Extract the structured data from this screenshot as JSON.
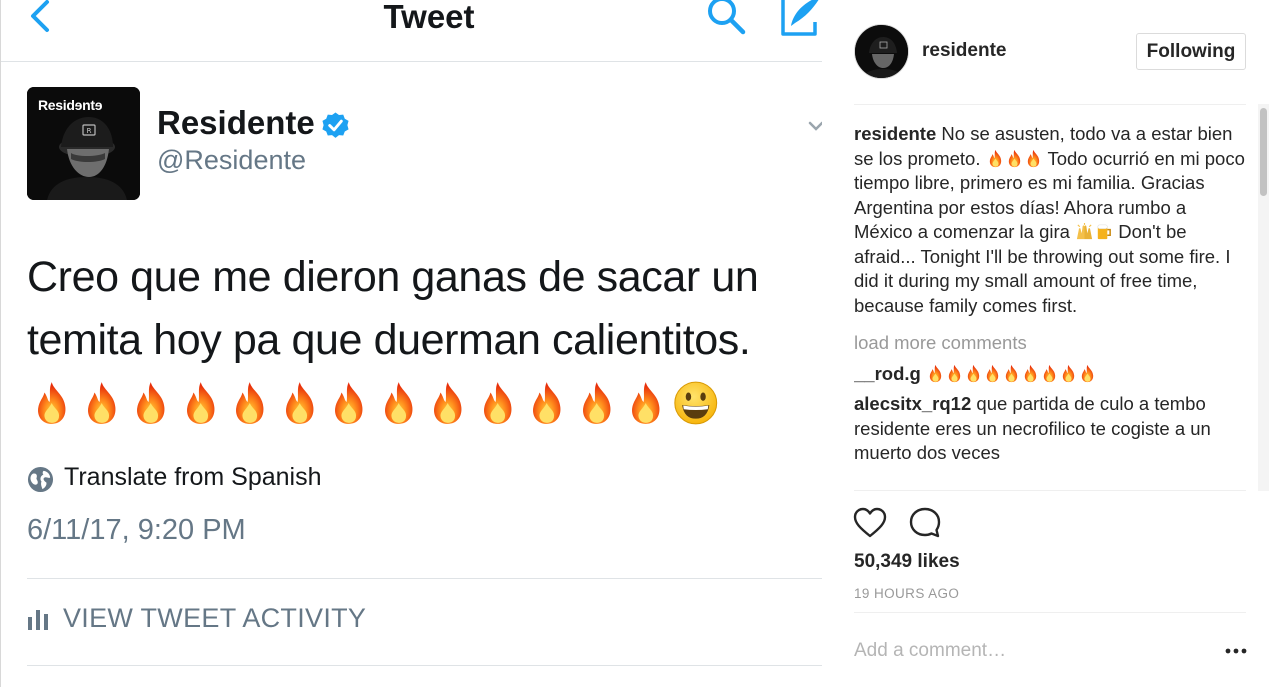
{
  "tweet": {
    "header_title": "Tweet",
    "avatar_text": "Residɘntɘ",
    "name": "Residente",
    "handle": "@Residente",
    "text": "Creo que me dieron ganas de sacar un temita hoy pa que duerman calientitos.",
    "emojis": [
      "fire",
      "fire",
      "fire",
      "fire",
      "fire",
      "fire",
      "fire",
      "fire",
      "fire",
      "fire",
      "fire",
      "fire",
      "fire",
      "grinning-face"
    ],
    "translate_label": "Translate from Spanish",
    "timestamp": "6/11/17, 9:20 PM",
    "activity_label": "VIEW TWEET ACTIVITY"
  },
  "instagram": {
    "username": "residente",
    "follow_label": "Following",
    "caption_user": "residente",
    "caption_part1": "No se asusten, todo va a estar bien se los prometo.",
    "caption_part2": "Todo ocurrió en mi poco tiempo libre, primero es mi familia. Gracias Argentina por estos días! Ahora rumbo a México a comenzar la gira",
    "caption_part3": "Don't be afraid... Tonight I'll be throwing out some fire. I did it during my small amount of free time, because family comes first.",
    "load_more": "load more comments",
    "comments": [
      {
        "user": "__rod.g",
        "text": "",
        "fire_count": 9
      },
      {
        "user": "alecsitx_rq12",
        "text": "que partida de culo a tembo residente eres un necrofilico te cogiste a un muerto dos veces"
      }
    ],
    "likes": "50,349 likes",
    "time_ago": "19 HOURS AGO",
    "add_comment_placeholder": "Add a comment…"
  },
  "colors": {
    "twitter_blue": "#1da1f2",
    "twitter_gray": "#657786",
    "ig_text": "#262626",
    "ig_muted": "#999999"
  },
  "icons": {
    "tweet_back": "chevron-left-icon",
    "tweet_search": "search-icon",
    "tweet_compose": "compose-icon",
    "verified": "verified-badge-icon",
    "translate": "globe-icon",
    "activity": "bar-chart-icon",
    "ig_like": "heart-icon",
    "ig_comment": "comment-bubble-icon",
    "ig_more": "more-options-icon"
  }
}
